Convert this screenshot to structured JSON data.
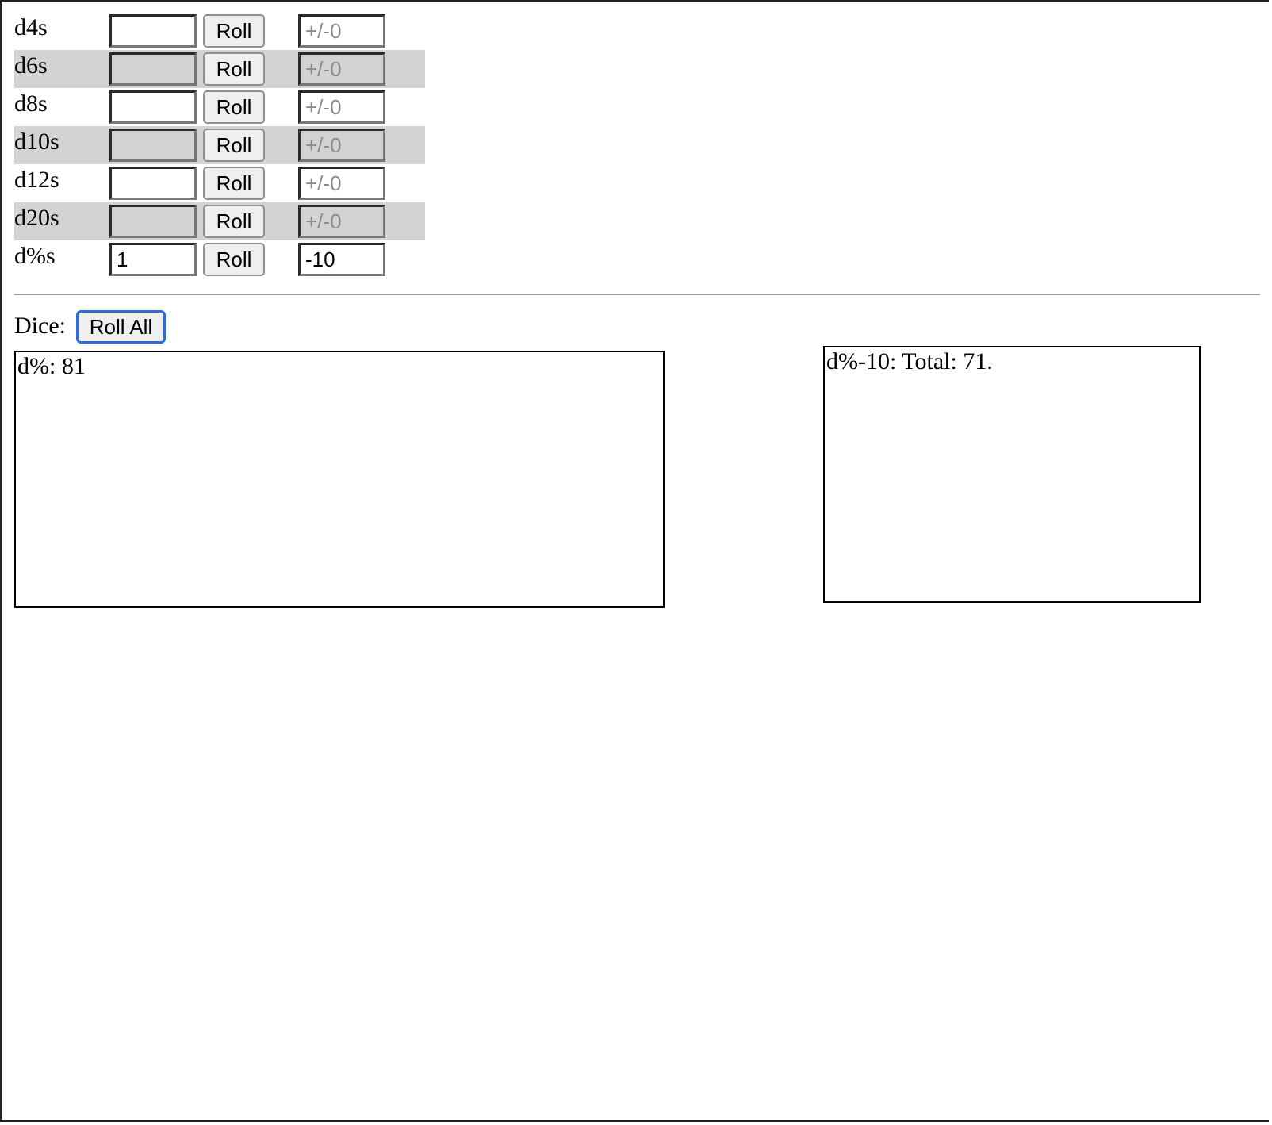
{
  "dice_rows": [
    {
      "label": "d4s",
      "count": "",
      "roll_label": "Roll",
      "modifier": "",
      "modifier_placeholder": "+/-0"
    },
    {
      "label": "d6s",
      "count": "",
      "roll_label": "Roll",
      "modifier": "",
      "modifier_placeholder": "+/-0"
    },
    {
      "label": "d8s",
      "count": "",
      "roll_label": "Roll",
      "modifier": "",
      "modifier_placeholder": "+/-0"
    },
    {
      "label": "d10s",
      "count": "",
      "roll_label": "Roll",
      "modifier": "",
      "modifier_placeholder": "+/-0"
    },
    {
      "label": "d12s",
      "count": "",
      "roll_label": "Roll",
      "modifier": "",
      "modifier_placeholder": "+/-0"
    },
    {
      "label": "d20s",
      "count": "",
      "roll_label": "Roll",
      "modifier": "",
      "modifier_placeholder": "+/-0"
    },
    {
      "label": "d%s",
      "count": "1",
      "roll_label": "Roll",
      "modifier": "-10",
      "modifier_placeholder": "+/-0"
    }
  ],
  "dice_bar": {
    "label": "Dice:",
    "roll_all_label": "Roll All"
  },
  "results": {
    "text": "d%: 81"
  },
  "totals": {
    "text": "d%-10: Total: 71."
  }
}
